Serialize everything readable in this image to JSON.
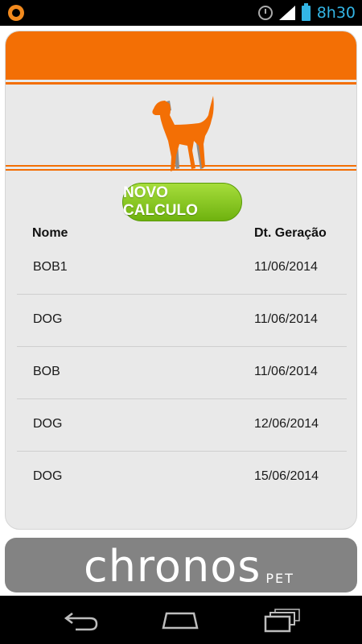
{
  "status_bar": {
    "time": "8h30",
    "icons": [
      "app-notification-icon",
      "alarm-icon",
      "signal-icon",
      "battery-icon"
    ]
  },
  "colors": {
    "accent_orange": "#f36f05",
    "button_green": "#8cc63f",
    "footer_gray": "#838383",
    "status_blue": "#33b5e5"
  },
  "header": {
    "illustration": "dog-icon"
  },
  "actions": {
    "novo_calculo_label": "NOVO CALCULO"
  },
  "table": {
    "columns": [
      "Nome",
      "Dt. Geração"
    ],
    "rows": [
      {
        "name": "BOB1",
        "date": "11/06/2014"
      },
      {
        "name": "DOG",
        "date": "11/06/2014"
      },
      {
        "name": "BOB",
        "date": "11/06/2014"
      },
      {
        "name": "DOG",
        "date": "12/06/2014"
      },
      {
        "name": "DOG",
        "date": "15/06/2014"
      }
    ]
  },
  "footer": {
    "logo_text": "chronos",
    "logo_sub": "PET"
  },
  "nav": {
    "buttons": [
      "back-icon",
      "home-icon",
      "recent-apps-icon"
    ]
  }
}
